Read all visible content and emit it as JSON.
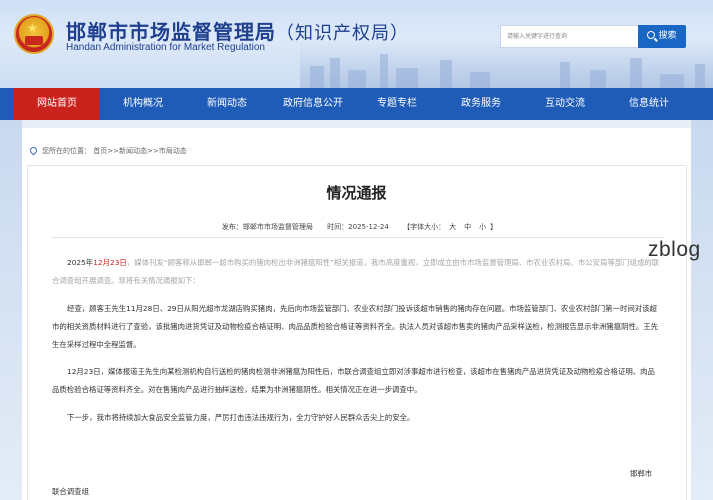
{
  "header": {
    "title": "邯郸市市场监督管理局",
    "title_sub": "（知识产权局）",
    "title_en": "Handan Administration for Market Regulation",
    "search_placeholder": "请输入关键字进行查询",
    "search_label": "搜索"
  },
  "nav": {
    "items": [
      {
        "label": "网站首页",
        "active": true
      },
      {
        "label": "机构概况"
      },
      {
        "label": "新闻动态"
      },
      {
        "label": "政府信息公开"
      },
      {
        "label": "专题专栏"
      },
      {
        "label": "政务服务"
      },
      {
        "label": "互动交流"
      },
      {
        "label": "信息统计"
      }
    ],
    "active_color": "#c9211c",
    "bar_color": "#1f5cb7"
  },
  "breadcrumb": {
    "prefix": "您所在的位置：",
    "path": "首页>>新闻动态>>市局动态"
  },
  "article": {
    "title": "情况通报",
    "publisher": "发布：邯郸市市场监督管理局",
    "time": "时间：2025-12-24",
    "font_size_label": "【字体大小：",
    "font_large": "大",
    "font_medium": "中",
    "font_small": "小",
    "font_close": "】",
    "p1_date": "2025年",
    "p1_highlight": "12月23日",
    "p1_rest": "，媒体刊发“顾客称从邯郸一超市购买的猪肉检出非洲猪瘟阳性”相关报道，我市高度重视，立即成立由市市场监督管理局、市农业农村局、市公安局等部门组成的联合调查组开展调查。现将有关情况通报如下：",
    "p2": "经查，顾客王先生11月28日、29日从阳光超市龙湖店购买猪肉，先后向市场监管部门、农业农村部门投诉该超市销售的猪肉存在问题。市场监管部门、农业农村部门第一时间对该超市的相关资质材料进行了查验，该批猪肉进货凭证及动物检疫合格证明、肉品品质检验合格证等资料齐全。执法人员对该超市售卖的猪肉产品采样送检，检测报告显示非洲猪瘟阴性。王先生在采样过程中全程监督。",
    "p3": "12月23日，媒体报道王先生向某检测机构自行送检的猪肉检测非洲猪瘟为阳性后，市联合调查组立即对涉事超市进行检查，该超市在售猪肉产品进货凭证及动物检疫合格证明、肉品品质检验合格证等资料齐全。对在售猪肉产品进行抽样送检，结果为非洲猪瘟阴性。相关情况正在进一步调查中。",
    "p4": "下一步，我市将持续加大食品安全监管力度，严厉打击违法违规行为，全力守护好人民群众舌尖上的安全。",
    "sign_city": "邯郸市",
    "sign_team": "联合调查组"
  },
  "watermark": "zblog",
  "icons": [
    "emblem-icon",
    "search-icon",
    "location-pin-icon"
  ]
}
